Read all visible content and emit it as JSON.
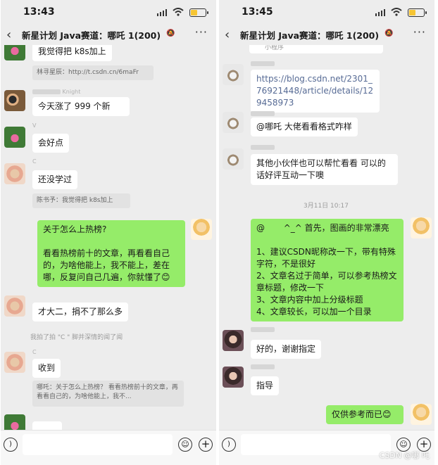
{
  "status_left": {
    "time": "13:43"
  },
  "status_right": {
    "time": "13:45"
  },
  "chat_title": "新星计划 Java赛道：哪吒 1(200)",
  "nav": {
    "back": "‹",
    "more": "···",
    "mute_icon": "bell-mute-icon"
  },
  "left_messages": {
    "m1_text": "我觉得把 k8s加上",
    "m1_quote": "林寻星辰：http://t.csdn.cn/6maFr",
    "m2_nick": "Knight",
    "m2_text": "今天涨了 999 个新",
    "m3_nick": "V",
    "m3_text": "会好点",
    "m4_nick": "C",
    "m4_text": "还没学过",
    "m4_quote": "陈书予：我觉得把 k8s加上",
    "m5_text": "关于怎么上热榜?\n\n看看热榜前十的文章，再看看自己的，为啥他能上，我不能上，差在哪，反复问自己几遍，你就懂了😊",
    "m6_text": "才大二，捐不了那么多",
    "sys_pat": "我拍了拍 \"C              \" 脚并深情的闻了闻",
    "m7_nick": "C",
    "m7_text": "收到",
    "m7_quote": "哪吒：关于怎么上热榜？ 看看热榜前十的文章，再看看自己的，为啥他能上，我不..."
  },
  "right_messages": {
    "miniprogram": "小程序",
    "r1_text": "https://blog.csdn.net/2301_76921448/article/details/129458973",
    "r2_text": "@哪吒 大佬看看格式咋样",
    "r3_text": "其他小伙伴也可以帮忙看看 可以的话好评互动一下噢",
    "timestamp": "3月11日 10:17",
    "r4_text": "@       ^_^ 首先，图画的非常漂亮\n\n1、建议CSDN昵称改一下，带有特殊字符，不是很好\n2、文章名过于简单，可以参考热榜文章标题，修改一下\n3、文章内容中加上分级标题\n4、文章较长，可以加一个目录",
    "r5_text": "好的，谢谢指定",
    "r6_text": "指导",
    "r7_text": "仅供参考而已😊"
  },
  "input": {
    "voice_icon": "voice-icon",
    "emoji_icon": "emoji-icon",
    "plus_icon": "plus-icon"
  },
  "watermark": "CSDN @哪 吒"
}
